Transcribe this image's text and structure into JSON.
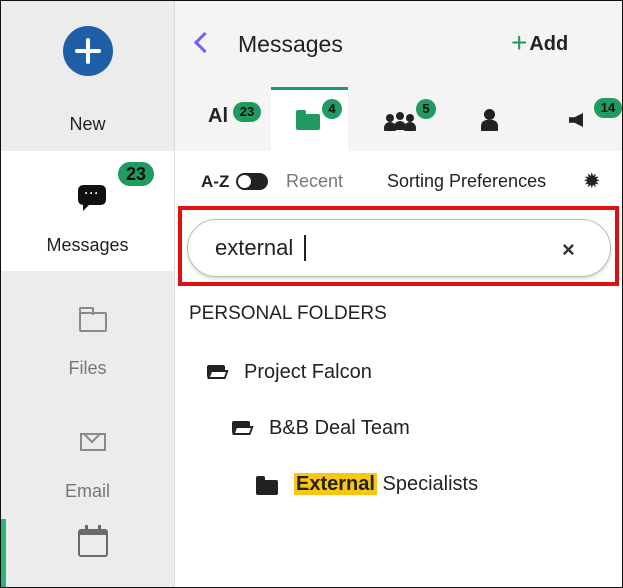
{
  "rail": {
    "new_label": "New",
    "messages_label": "Messages",
    "messages_badge": "23",
    "files_label": "Files",
    "email_label": "Email"
  },
  "header": {
    "title": "Messages",
    "add_label": "Add"
  },
  "tabs": {
    "all_label": "Al",
    "all_badge": "23",
    "folders_badge": "4",
    "groups_badge": "5",
    "broadcast_badge": "14"
  },
  "sort": {
    "az_label": "A-Z",
    "recent_label": "Recent",
    "preferences_label": "Sorting Preferences"
  },
  "search": {
    "value": "external",
    "clear_glyph": "×"
  },
  "folders": {
    "section_title": "PERSONAL FOLDERS",
    "items": [
      {
        "label": "Project Falcon",
        "depth": 0
      },
      {
        "label": "B&B Deal Team",
        "depth": 1
      },
      {
        "highlight": "External",
        "rest": " Specialists",
        "depth": 2
      }
    ]
  },
  "colors": {
    "accent_green": "#1f9a60",
    "new_button_blue": "#1f5fa8",
    "back_arrow_purple": "#7b5cf5",
    "search_highlight_red": "#e01010",
    "match_highlight_yellow": "#f9c710"
  }
}
